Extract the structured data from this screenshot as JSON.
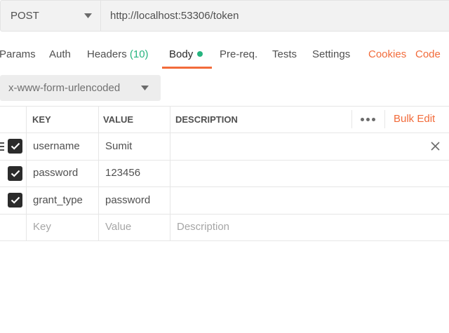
{
  "request": {
    "method": "POST",
    "url": "http://localhost:53306/token"
  },
  "tabs": {
    "params": "Params",
    "auth": "Auth",
    "headers": "Headers",
    "headers_count": "(10)",
    "body": "Body",
    "prereq": "Pre-req.",
    "tests": "Tests",
    "settings": "Settings",
    "cookies": "Cookies",
    "code": "Code"
  },
  "body_type": "x-www-form-urlencoded",
  "table": {
    "headers": {
      "key": "KEY",
      "value": "VALUE",
      "description": "DESCRIPTION"
    },
    "bulk_edit": "Bulk Edit",
    "rows": [
      {
        "key": "username",
        "value": "Sumit",
        "checked": true
      },
      {
        "key": "password",
        "value": "123456",
        "checked": true
      },
      {
        "key": "grant_type",
        "value": "password",
        "checked": true
      }
    ],
    "placeholders": {
      "key": "Key",
      "value": "Value",
      "description": "Description"
    }
  },
  "colors": {
    "accent": "#f26b3a",
    "success": "#26b47f",
    "checkbox": "#2b2b2b"
  }
}
